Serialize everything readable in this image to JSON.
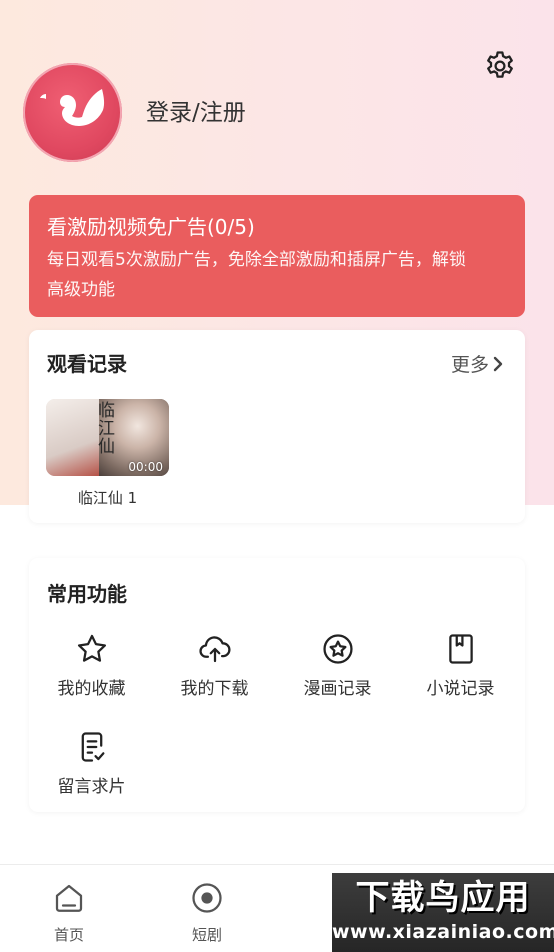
{
  "header": {
    "login_label": "登录/注册",
    "settings_icon": "gear-icon",
    "avatar_icon": "swan-logo-icon"
  },
  "banner": {
    "title": "看激励视频免广告(0/5)",
    "desc_line1": "每日观看5次激励广告，免除全部激励和插屏广告，解锁",
    "desc_line2": "高级功能",
    "color": "#ea5d5e"
  },
  "history": {
    "title": "观看记录",
    "more_label": "更多",
    "items": [
      {
        "title": "临江仙 1",
        "poster_text": "临江仙",
        "time": "00:00"
      }
    ]
  },
  "functions": {
    "title": "常用功能",
    "items": [
      {
        "label": "我的收藏",
        "icon": "star-icon"
      },
      {
        "label": "我的下载",
        "icon": "cloud-upload-icon"
      },
      {
        "label": "漫画记录",
        "icon": "star-circle-icon"
      },
      {
        "label": "小说记录",
        "icon": "book-icon"
      },
      {
        "label": "留言求片",
        "icon": "note-check-icon"
      }
    ]
  },
  "bottom_nav": {
    "items": [
      {
        "label": "首页",
        "icon": "home-icon"
      },
      {
        "label": "短剧",
        "icon": "play-circle-icon"
      }
    ]
  },
  "watermark": {
    "title": "下载鸟应用",
    "url": "www.xiazainiao.com"
  }
}
